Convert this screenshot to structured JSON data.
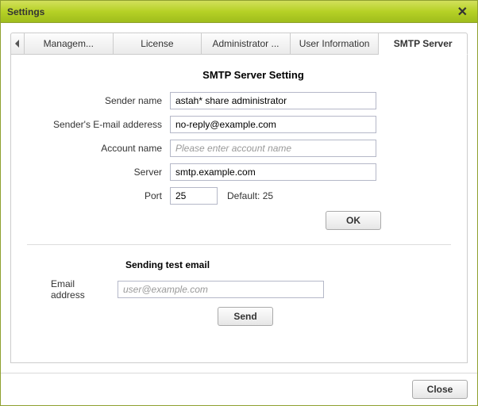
{
  "window": {
    "title": "Settings",
    "close_label": "Close"
  },
  "tabs": [
    {
      "label": "Managem..."
    },
    {
      "label": "License"
    },
    {
      "label": "Administrator ..."
    },
    {
      "label": "User Information"
    },
    {
      "label": "SMTP Server"
    }
  ],
  "smtp": {
    "section_title": "SMTP Server Setting",
    "sender_name_label": "Sender name",
    "sender_name_value": "astah* share administrator",
    "sender_email_label": "Sender's E-mail adderess",
    "sender_email_value": "no-reply@example.com",
    "account_name_label": "Account name",
    "account_name_placeholder": "Please enter account name",
    "server_label": "Server",
    "server_value": "smtp.example.com",
    "port_label": "Port",
    "port_value": "25",
    "port_default_text": "Default: 25",
    "ok_label": "OK"
  },
  "test": {
    "section_title": "Sending test email",
    "email_label": "Email address",
    "email_placeholder": "user@example.com",
    "send_label": "Send"
  }
}
